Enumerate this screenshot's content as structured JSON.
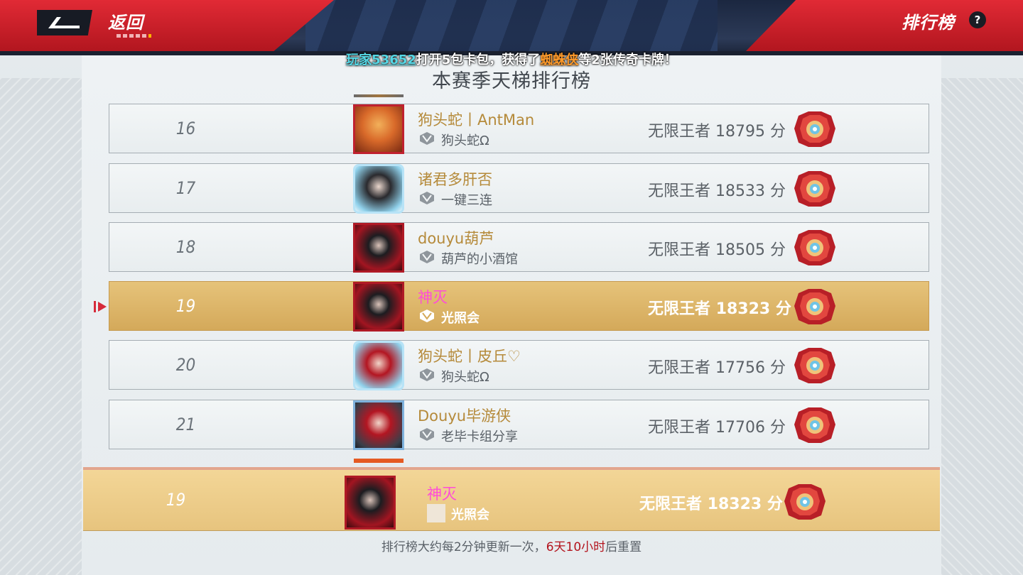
{
  "header": {
    "back_label": "返回",
    "page_title": "排行榜",
    "help_label": "?"
  },
  "ticker": {
    "player": "玩家53652",
    "text_before": "打开5包卡包，获得了",
    "card": "蜘蛛侠",
    "text_after": "等2张传奇卡牌！"
  },
  "section_title": "本赛季天梯排行榜",
  "rows": [
    {
      "rank": "16",
      "name": "狗头蛇丨AntMan",
      "guild": "狗头蛇Ω",
      "title": "无限王者",
      "score": "18795",
      "unit": "分",
      "selected": false
    },
    {
      "rank": "17",
      "name": "诸君多肝否",
      "guild": "一键三连",
      "title": "无限王者",
      "score": "18533",
      "unit": "分",
      "selected": false
    },
    {
      "rank": "18",
      "name": "douyu葫芦",
      "guild": "葫芦的小酒馆",
      "title": "无限王者",
      "score": "18505",
      "unit": "分",
      "selected": false
    },
    {
      "rank": "19",
      "name": "神灭",
      "guild": "光照会",
      "title": "无限王者",
      "score": "18323",
      "unit": "分",
      "selected": true
    },
    {
      "rank": "20",
      "name": "狗头蛇丨皮丘♡",
      "guild": "狗头蛇Ω",
      "title": "无限王者",
      "score": "17756",
      "unit": "分",
      "selected": false
    },
    {
      "rank": "21",
      "name": "Douyu毕游侠",
      "guild": "老毕卡组分享",
      "title": "无限王者",
      "score": "17706",
      "unit": "分",
      "selected": false
    }
  ],
  "my_rank": {
    "rank": "19",
    "name": "神灭",
    "guild": "光照会",
    "title": "无限王者",
    "score": "18323",
    "unit": "分"
  },
  "footer": {
    "text_before": "排行榜大约每2分钟更新一次，",
    "timer": "6天10小时",
    "text_after": "后重置"
  },
  "colors": {
    "header_red": "#d21f2a",
    "name_gold": "#b58a3a",
    "name_pink": "#ff4cd8",
    "selected_row": "#dcb467",
    "timer_red": "#b3141d"
  },
  "icons": {
    "back": "back-arrow-icon",
    "help": "question-icon",
    "guild": "guild-emblem-icon",
    "rank": "infinite-king-rank-badge-icon",
    "marker": "current-player-marker-icon"
  }
}
